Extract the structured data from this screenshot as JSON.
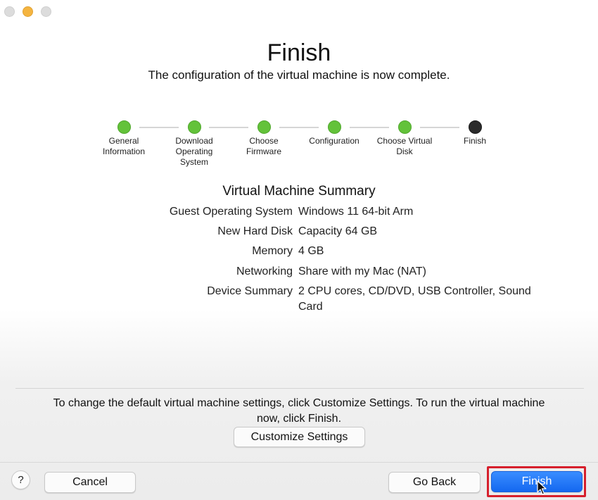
{
  "dialog": {
    "title": "Finish",
    "subtitle": "The configuration of the virtual machine is now complete."
  },
  "steps": [
    {
      "label": "General Information",
      "state": "done"
    },
    {
      "label": "Download Operating System",
      "state": "done"
    },
    {
      "label": "Choose Firmware",
      "state": "done"
    },
    {
      "label": "Configuration",
      "state": "done"
    },
    {
      "label": "Choose Virtual Disk",
      "state": "done"
    },
    {
      "label": "Finish",
      "state": "current"
    }
  ],
  "summary": {
    "title": "Virtual Machine Summary",
    "rows": [
      {
        "key": "Guest Operating System",
        "value": "Windows 11 64-bit Arm"
      },
      {
        "key": "New Hard Disk",
        "value": "Capacity 64 GB"
      },
      {
        "key": "Memory",
        "value": "4 GB"
      },
      {
        "key": "Networking",
        "value": "Share with my Mac (NAT)"
      },
      {
        "key": "Device Summary",
        "value": "2 CPU cores, CD/DVD, USB Controller, Sound Card"
      }
    ]
  },
  "footer": {
    "hint": "To change the default virtual machine settings, click Customize Settings. To run the virtual machine now, click Finish.",
    "customize_label": "Customize Settings",
    "help_label": "?",
    "cancel_label": "Cancel",
    "goback_label": "Go Back",
    "finish_label": "Finish"
  },
  "colors": {
    "step_done": "#63c23a",
    "step_current": "#2b2b2b",
    "primary_button": "#1f74f5",
    "highlight_frame": "#d61f2c"
  }
}
